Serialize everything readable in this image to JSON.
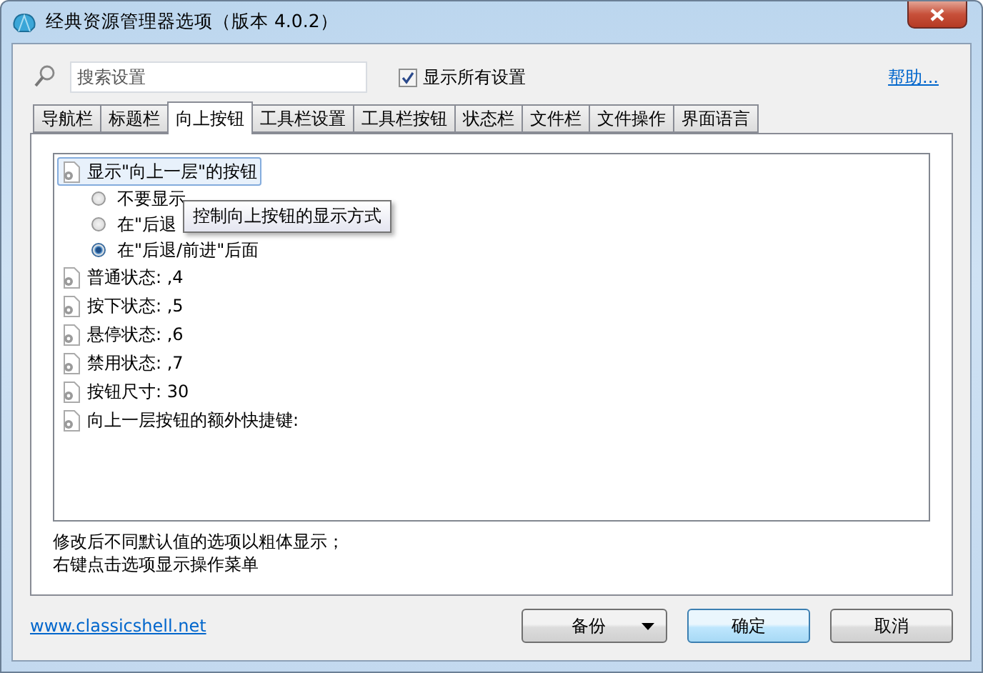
{
  "window": {
    "title": "经典资源管理器选项（版本 4.0.2）"
  },
  "search": {
    "placeholder": "搜索设置"
  },
  "show_all": {
    "label": "显示所有设置",
    "checked": true
  },
  "help_link": "帮助...",
  "tabs": [
    {
      "label": "导航栏",
      "selected": false
    },
    {
      "label": "标题栏",
      "selected": false
    },
    {
      "label": "向上按钮",
      "selected": true
    },
    {
      "label": "工具栏设置",
      "selected": false
    },
    {
      "label": "工具栏按钮",
      "selected": false
    },
    {
      "label": "状态栏",
      "selected": false
    },
    {
      "label": "文件栏",
      "selected": false
    },
    {
      "label": "文件操作",
      "selected": false
    },
    {
      "label": "界面语言",
      "selected": false
    }
  ],
  "settings": [
    {
      "label": "显示\"向上一层\"的按钮",
      "selected": true,
      "children": [
        {
          "label": "不要显示",
          "selected": false
        },
        {
          "label": "在\"后退",
          "selected": false
        },
        {
          "label": "在\"后退/前进\"后面",
          "selected": true
        }
      ]
    },
    {
      "label": "普通状态: ,4",
      "selected": false
    },
    {
      "label": "按下状态: ,5",
      "selected": false
    },
    {
      "label": "悬停状态: ,6",
      "selected": false
    },
    {
      "label": "禁用状态: ,7",
      "selected": false
    },
    {
      "label": "按钮尺寸: 30",
      "selected": false
    },
    {
      "label": "向上一层按钮的额外快捷键:",
      "selected": false
    }
  ],
  "tooltip": "控制向上按钮的显示方式",
  "hints": [
    "修改后不同默认值的选项以粗体显示；",
    "右键点击选项显示操作菜单"
  ],
  "website_link": "www.classicshell.net",
  "buttons": {
    "backup": "备份",
    "ok": "确定",
    "cancel": "取消"
  }
}
